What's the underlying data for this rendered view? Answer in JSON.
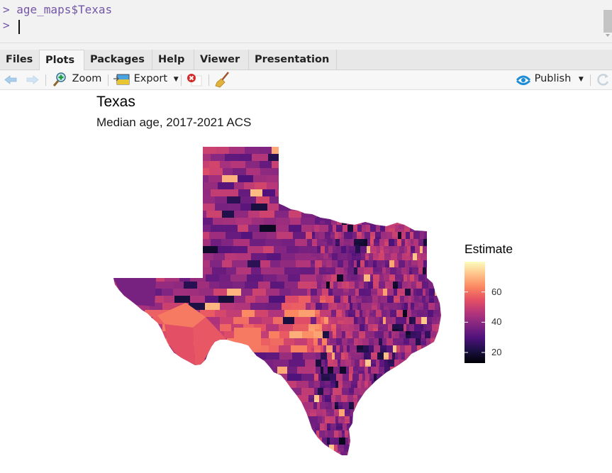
{
  "console": {
    "lines": [
      "> age_maps$Texas",
      "> "
    ]
  },
  "tabs": [
    {
      "label": "Files",
      "active": false
    },
    {
      "label": "Plots",
      "active": true
    },
    {
      "label": "Packages",
      "active": false
    },
    {
      "label": "Help",
      "active": false
    },
    {
      "label": "Viewer",
      "active": false
    },
    {
      "label": "Presentation",
      "active": false
    }
  ],
  "toolbar": {
    "back_icon": "arrow-left-icon",
    "forward_icon": "arrow-right-icon",
    "zoom_label": "Zoom",
    "export_label": "Export",
    "remove_icon": "remove-plot-icon",
    "clear_icon": "broom-icon",
    "publish_label": "Publish",
    "refresh_icon": "refresh-icon"
  },
  "plot": {
    "title": "Texas",
    "subtitle": "Median age, 2017-2021 ACS",
    "legend": {
      "title": "Estimate",
      "ticks": [
        "60",
        "40",
        "20"
      ],
      "tick_values": [
        60,
        40,
        20
      ],
      "range": [
        13,
        80
      ],
      "palette": [
        "#000004",
        "#1c1044",
        "#4f127b",
        "#812581",
        "#b5367a",
        "#e55064",
        "#fb8761",
        "#fec287",
        "#fcfdbf"
      ]
    }
  },
  "colors": {
    "accent_publish": "#1f8dd6",
    "console_text": "#7356a8"
  }
}
